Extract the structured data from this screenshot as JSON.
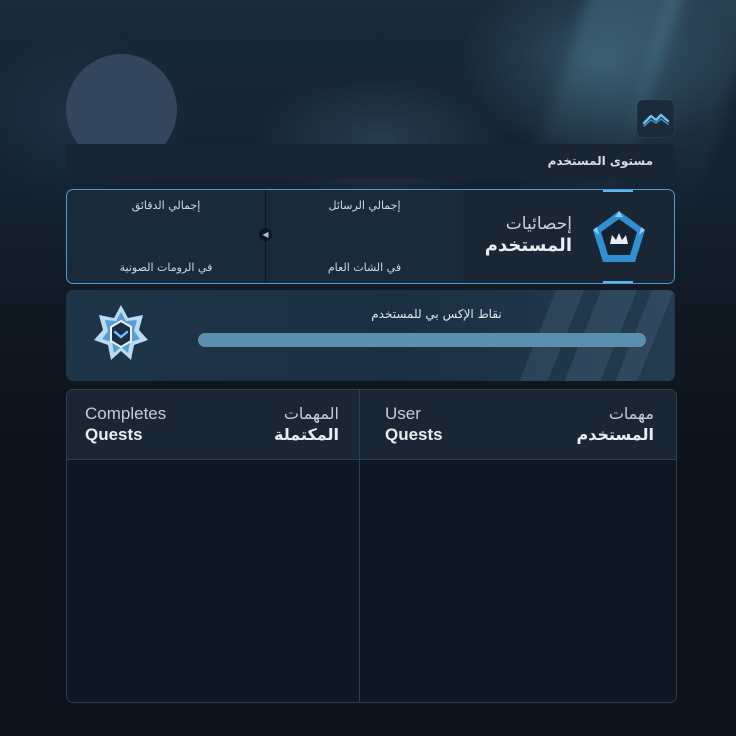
{
  "profile": {
    "level_label": "مستوى المستخدم",
    "level_icon": "chart-trend-icon"
  },
  "stats": {
    "title_line1": "إحصائيات",
    "title_line2": "المستخدم",
    "emblem_icon": "crown-pentagon-icon",
    "messages_label": "إجمالي الرسائل",
    "messages_sub": "في الشات العام",
    "minutes_label": "إجمالي الدقائق",
    "minutes_sub": "في الرومات الصوتية",
    "toggle_icon": "arrow-left-icon",
    "accent_color": "#4a9ed6"
  },
  "xp": {
    "label": "نقاط الإكس بي للمستخدم",
    "progress": 1.0,
    "badge_icon": "star-crystal-badge-icon",
    "bar_color": "#5a8fae"
  },
  "quests": {
    "user_ar_1": "مهمات",
    "user_ar_2": "المستخدم",
    "user_en_1": "User",
    "user_en_2": "Quests",
    "done_ar_1": "المهمات",
    "done_ar_2": "المكتملة",
    "done_en_1": "Completes",
    "done_en_2": "Quests"
  }
}
